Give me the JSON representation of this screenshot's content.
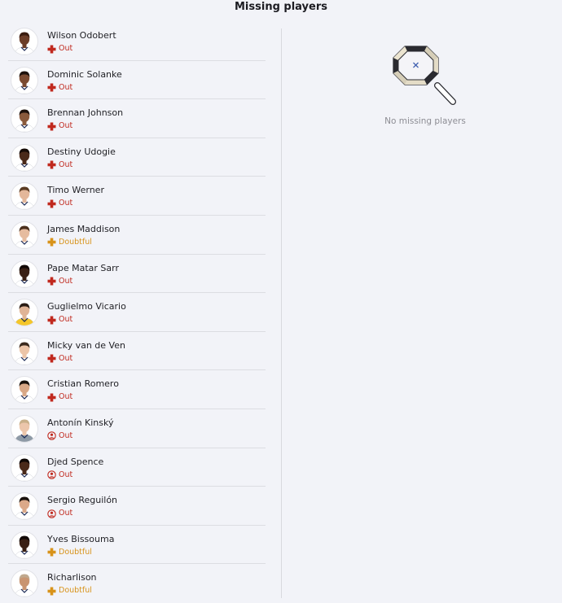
{
  "header": {
    "title": "Missing players"
  },
  "left": {
    "players": [
      {
        "name": "Wilson Odobert",
        "status": "Out",
        "status_type": "injury",
        "skin": "#6b3d28",
        "hair": "#3a1c10",
        "kit": "#ffffff"
      },
      {
        "name": "Dominic Solanke",
        "status": "Out",
        "status_type": "injury",
        "skin": "#7a4a30",
        "hair": "#1e120c",
        "kit": "#ffffff"
      },
      {
        "name": "Brennan Johnson",
        "status": "Out",
        "status_type": "injury",
        "skin": "#8a5a3c",
        "hair": "#1e120c",
        "kit": "#ffffff"
      },
      {
        "name": "Destiny Udogie",
        "status": "Out",
        "status_type": "injury",
        "skin": "#4a2a1a",
        "hair": "#150b06",
        "kit": "#ffffff"
      },
      {
        "name": "Timo Werner",
        "status": "Out",
        "status_type": "injury",
        "skin": "#e3b79a",
        "hair": "#5a3b22",
        "kit": "#ffffff"
      },
      {
        "name": "James Maddison",
        "status": "Doubtful",
        "status_type": "injury",
        "skin": "#e6bc9f",
        "hair": "#4a2f1c",
        "kit": "#ffffff"
      },
      {
        "name": "Pape Matar Sarr",
        "status": "Out",
        "status_type": "injury",
        "skin": "#3a2014",
        "hair": "#120905",
        "kit": "#ffffff"
      },
      {
        "name": "Guglielmo Vicario",
        "status": "Out",
        "status_type": "injury",
        "skin": "#e0b496",
        "hair": "#2a1c14",
        "kit": "#f4c62a"
      },
      {
        "name": "Micky van de Ven",
        "status": "Out",
        "status_type": "injury",
        "skin": "#ecc5a8",
        "hair": "#3b2a1e",
        "kit": "#ffffff"
      },
      {
        "name": "Cristian Romero",
        "status": "Out",
        "status_type": "injury",
        "skin": "#d9a886",
        "hair": "#1a120c",
        "kit": "#ffffff"
      },
      {
        "name": "Antonín Kinský",
        "status": "Out",
        "status_type": "other",
        "skin": "#ecc6ab",
        "hair": "#c9b08a",
        "kit": "#8e9aa6"
      },
      {
        "name": "Djed Spence",
        "status": "Out",
        "status_type": "other",
        "skin": "#4a2a1a",
        "hair": "#0e0704",
        "kit": "#ffffff"
      },
      {
        "name": "Sergio Reguilón",
        "status": "Out",
        "status_type": "other",
        "skin": "#dba989",
        "hair": "#1a120c",
        "kit": "#ffffff"
      },
      {
        "name": "Yves Bissouma",
        "status": "Doubtful",
        "status_type": "injury",
        "skin": "#3a2014",
        "hair": "#110805",
        "kit": "#ffffff"
      },
      {
        "name": "Richarlison",
        "status": "Doubtful",
        "status_type": "injury",
        "skin": "#c99572",
        "hair": "#c0a98e",
        "kit": "#ffffff"
      }
    ]
  },
  "right": {
    "empty_text": "No missing players",
    "empty_icon": "magnifier-icon"
  },
  "colors": {
    "out": "#c0291e",
    "doubtful": "#d8931a",
    "background": "#f2f3f8"
  }
}
